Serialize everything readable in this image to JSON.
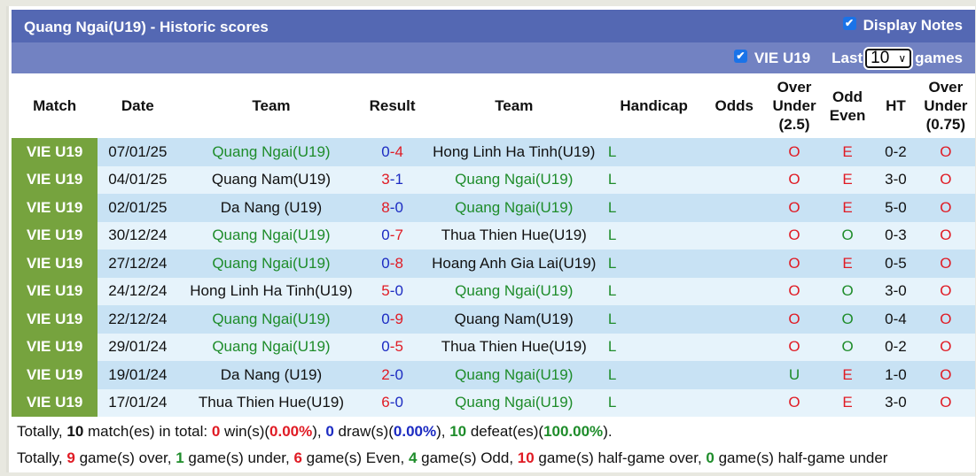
{
  "header": {
    "title": "Quang Ngai(U19) - Historic scores",
    "display_notes_label": "Display Notes",
    "display_notes_checked": true
  },
  "filter": {
    "team_filter_label": "VIE U19",
    "team_filter_checked": true,
    "last_label": "Last",
    "games_count": "10",
    "games_label": "games"
  },
  "columns": [
    "Match",
    "Date",
    "Team",
    "Result",
    "Team",
    "Handicap",
    "Odds",
    "Over Under (2.5)",
    "Odd Even",
    "HT",
    "Over Under (0.75)"
  ],
  "column_lines": {
    "ou25": [
      "Over",
      "Under",
      "(2.5)"
    ],
    "oddeven": [
      "Odd",
      "Even"
    ],
    "ou075": [
      "Over",
      "Under",
      "(0.75)"
    ]
  },
  "rows": [
    {
      "match": "VIE U19",
      "date": "07/01/25",
      "home": "Quang Ngai(U19)",
      "home_hl": true,
      "hs": "0",
      "as": "4",
      "away": "Hong Linh Ha Tinh(U19)",
      "away_hl": false,
      "res": "L",
      "handicap": "",
      "odds": "",
      "ou": "O",
      "oe": "E",
      "ht": "0-2",
      "ou075": "O"
    },
    {
      "match": "VIE U19",
      "date": "04/01/25",
      "home": "Quang Nam(U19)",
      "home_hl": false,
      "hs": "3",
      "as": "1",
      "away": "Quang Ngai(U19)",
      "away_hl": true,
      "res": "L",
      "handicap": "",
      "odds": "",
      "ou": "O",
      "oe": "E",
      "ht": "3-0",
      "ou075": "O"
    },
    {
      "match": "VIE U19",
      "date": "02/01/25",
      "home": "Da Nang (U19)",
      "home_hl": false,
      "hs": "8",
      "as": "0",
      "away": "Quang Ngai(U19)",
      "away_hl": true,
      "res": "L",
      "handicap": "",
      "odds": "",
      "ou": "O",
      "oe": "E",
      "ht": "5-0",
      "ou075": "O"
    },
    {
      "match": "VIE U19",
      "date": "30/12/24",
      "home": "Quang Ngai(U19)",
      "home_hl": true,
      "hs": "0",
      "as": "7",
      "away": "Thua Thien Hue(U19)",
      "away_hl": false,
      "res": "L",
      "handicap": "",
      "odds": "",
      "ou": "O",
      "oe": "O",
      "ht": "0-3",
      "ou075": "O"
    },
    {
      "match": "VIE U19",
      "date": "27/12/24",
      "home": "Quang Ngai(U19)",
      "home_hl": true,
      "hs": "0",
      "as": "8",
      "away": "Hoang Anh Gia Lai(U19)",
      "away_hl": false,
      "res": "L",
      "handicap": "",
      "odds": "",
      "ou": "O",
      "oe": "E",
      "ht": "0-5",
      "ou075": "O"
    },
    {
      "match": "VIE U19",
      "date": "24/12/24",
      "home": "Hong Linh Ha Tinh(U19)",
      "home_hl": false,
      "hs": "5",
      "as": "0",
      "away": "Quang Ngai(U19)",
      "away_hl": true,
      "res": "L",
      "handicap": "",
      "odds": "",
      "ou": "O",
      "oe": "O",
      "ht": "3-0",
      "ou075": "O"
    },
    {
      "match": "VIE U19",
      "date": "22/12/24",
      "home": "Quang Ngai(U19)",
      "home_hl": true,
      "hs": "0",
      "as": "9",
      "away": "Quang Nam(U19)",
      "away_hl": false,
      "res": "L",
      "handicap": "",
      "odds": "",
      "ou": "O",
      "oe": "O",
      "ht": "0-4",
      "ou075": "O"
    },
    {
      "match": "VIE U19",
      "date": "29/01/24",
      "home": "Quang Ngai(U19)",
      "home_hl": true,
      "hs": "0",
      "as": "5",
      "away": "Thua Thien Hue(U19)",
      "away_hl": false,
      "res": "L",
      "handicap": "",
      "odds": "",
      "ou": "O",
      "oe": "O",
      "ht": "0-2",
      "ou075": "O"
    },
    {
      "match": "VIE U19",
      "date": "19/01/24",
      "home": "Da Nang (U19)",
      "home_hl": false,
      "hs": "2",
      "as": "0",
      "away": "Quang Ngai(U19)",
      "away_hl": true,
      "res": "L",
      "handicap": "",
      "odds": "",
      "ou": "U",
      "oe": "E",
      "ht": "1-0",
      "ou075": "O"
    },
    {
      "match": "VIE U19",
      "date": "17/01/24",
      "home": "Thua Thien Hue(U19)",
      "home_hl": false,
      "hs": "6",
      "as": "0",
      "away": "Quang Ngai(U19)",
      "away_hl": true,
      "res": "L",
      "handicap": "",
      "odds": "",
      "ou": "O",
      "oe": "E",
      "ht": "3-0",
      "ou075": "O"
    }
  ],
  "summary": {
    "line1": {
      "prefix": "Totally, ",
      "matches": "10",
      "t1": " match(es) in total: ",
      "wins": "0",
      "t2": " win(s)(",
      "win_pct": "0.00%",
      "t3": "), ",
      "draws": "0",
      "t4": " draw(s)(",
      "draw_pct": "0.00%",
      "t5": "), ",
      "defeats": "10",
      "t6": " defeat(es)(",
      "defeat_pct": "100.00%",
      "t7": ")."
    },
    "line2": {
      "prefix": "Totally, ",
      "over": "9",
      "t1": " game(s) over, ",
      "under": "1",
      "t2": " game(s) under, ",
      "even": "6",
      "t3": " game(s) Even, ",
      "odd": "4",
      "t4": " game(s) Odd, ",
      "hg_over": "10",
      "t5": " game(s) half-game over, ",
      "hg_under": "0",
      "t6": " game(s) half-game under"
    }
  },
  "colors": {
    "title_bar": "#5468b3",
    "sub_bar": "#7282c2",
    "match_cell": "#76a33e",
    "row_odd": "#c8e2f4",
    "row_even": "#e6f3fb",
    "highlight_team": "#1e8c2a",
    "red": "#e01b24",
    "blue": "#1c2bc2"
  }
}
